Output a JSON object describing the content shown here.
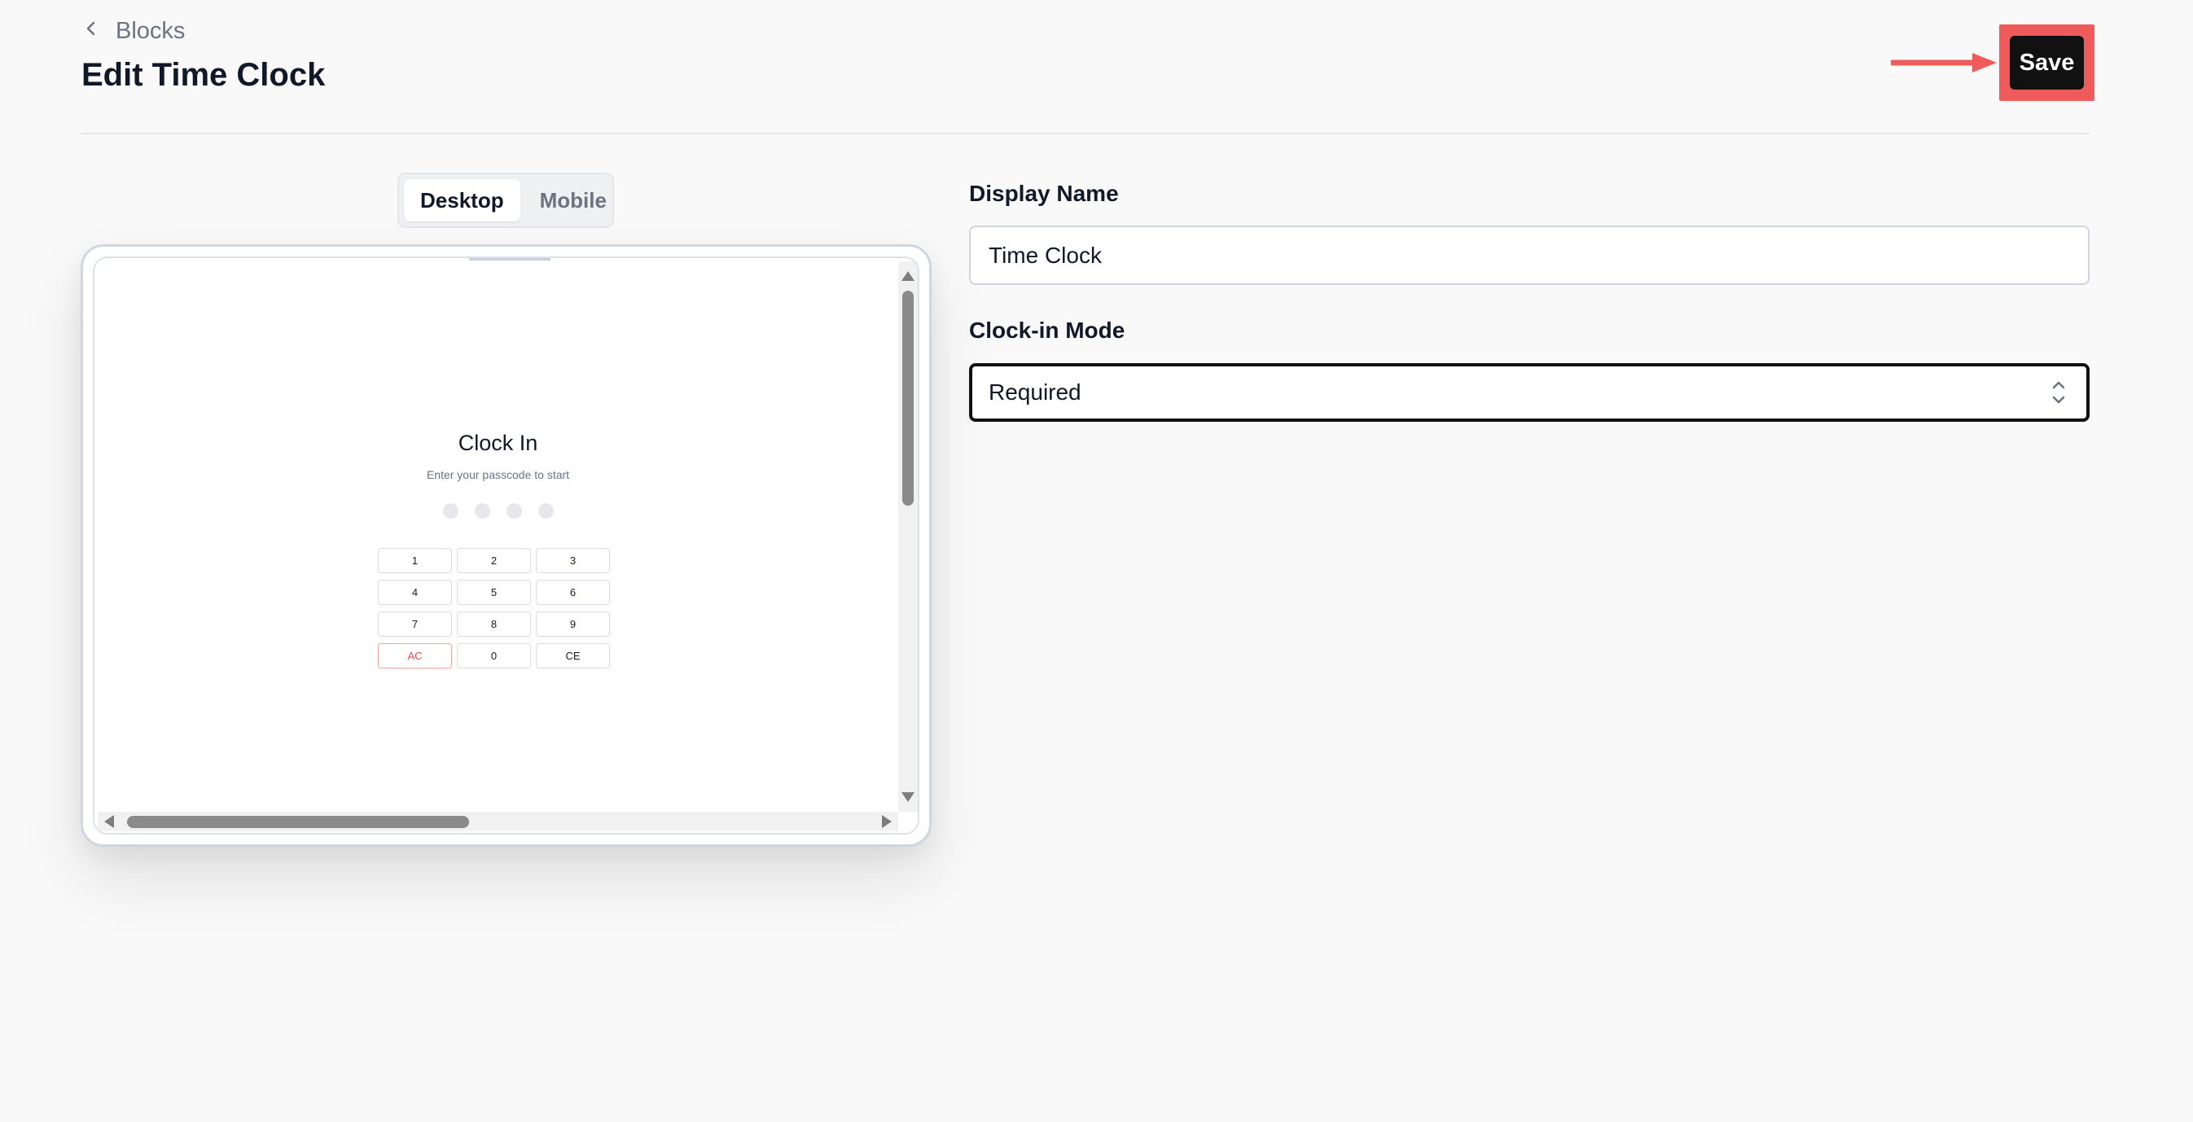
{
  "header": {
    "breadcrumb_label": "Blocks",
    "title": "Edit Time Clock",
    "save_label": "Save"
  },
  "annotation": {
    "highlight_color": "#ef5b5b"
  },
  "preview": {
    "view_options": [
      "Desktop",
      "Mobile"
    ],
    "selected_view": "Desktop",
    "screen": {
      "title": "Clock In",
      "subtitle": "Enter your passcode to start",
      "passcode_dot_count": 4,
      "keys": [
        "1",
        "2",
        "3",
        "4",
        "5",
        "6",
        "7",
        "8",
        "9",
        "AC",
        "0",
        "CE"
      ]
    }
  },
  "form": {
    "display_name_label": "Display Name",
    "display_name_value": "Time Clock",
    "clockin_mode_label": "Clock-in Mode",
    "clockin_mode_value": "Required"
  },
  "colors": {
    "save_button_bg": "#111111",
    "danger": "#ef4444",
    "accent": "#ef5b5b"
  }
}
